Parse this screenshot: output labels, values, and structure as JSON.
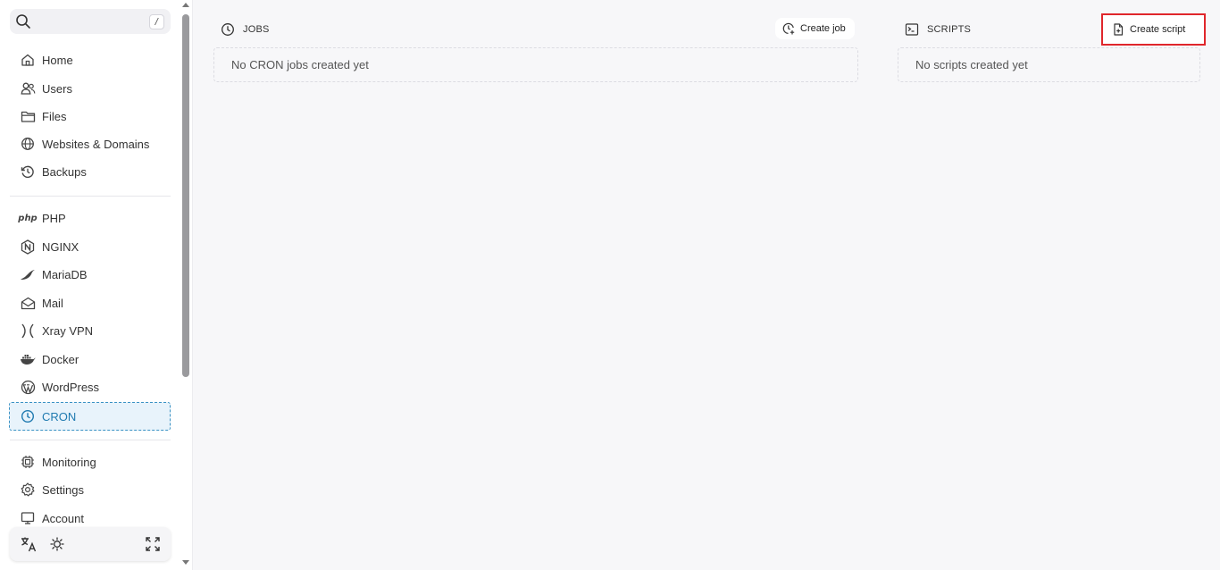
{
  "sidebar": {
    "search": {
      "shortcut": "/"
    },
    "items": [
      {
        "id": "home",
        "label": "Home",
        "icon": "home-icon"
      },
      {
        "id": "users",
        "label": "Users",
        "icon": "users-icon"
      },
      {
        "id": "files",
        "label": "Files",
        "icon": "folder-icon"
      },
      {
        "id": "websites",
        "label": "Websites & Domains",
        "icon": "globe-icon"
      },
      {
        "id": "backups",
        "label": "Backups",
        "icon": "history-icon"
      },
      {
        "id": "php",
        "label": "PHP",
        "icon": "php-icon"
      },
      {
        "id": "nginx",
        "label": "NGINX",
        "icon": "nginx-icon"
      },
      {
        "id": "mariadb",
        "label": "MariaDB",
        "icon": "mariadb-icon"
      },
      {
        "id": "mail",
        "label": "Mail",
        "icon": "mail-icon"
      },
      {
        "id": "xray",
        "label": "Xray VPN",
        "icon": "xray-icon"
      },
      {
        "id": "docker",
        "label": "Docker",
        "icon": "docker-icon"
      },
      {
        "id": "wordpress",
        "label": "WordPress",
        "icon": "wordpress-icon"
      },
      {
        "id": "cron",
        "label": "CRON",
        "icon": "clock-icon",
        "active": true
      },
      {
        "id": "monitoring",
        "label": "Monitoring",
        "icon": "chip-icon"
      },
      {
        "id": "settings",
        "label": "Settings",
        "icon": "gear-icon"
      },
      {
        "id": "account",
        "label": "Account",
        "icon": "monitor-icon"
      }
    ],
    "php_glyph": "php",
    "bottom_icons": [
      "translate-icon",
      "sun-icon",
      "fullscreen-icon"
    ]
  },
  "jobs": {
    "title": "JOBS",
    "create_label": "Create job",
    "empty_text": "No CRON jobs created yet"
  },
  "scripts": {
    "title": "SCRIPTS",
    "create_label": "Create script",
    "empty_text": "No scripts created yet"
  },
  "colors": {
    "active_bg": "#e8f3fb",
    "active_text": "#1f7ab0",
    "highlight": "#e0262b"
  }
}
